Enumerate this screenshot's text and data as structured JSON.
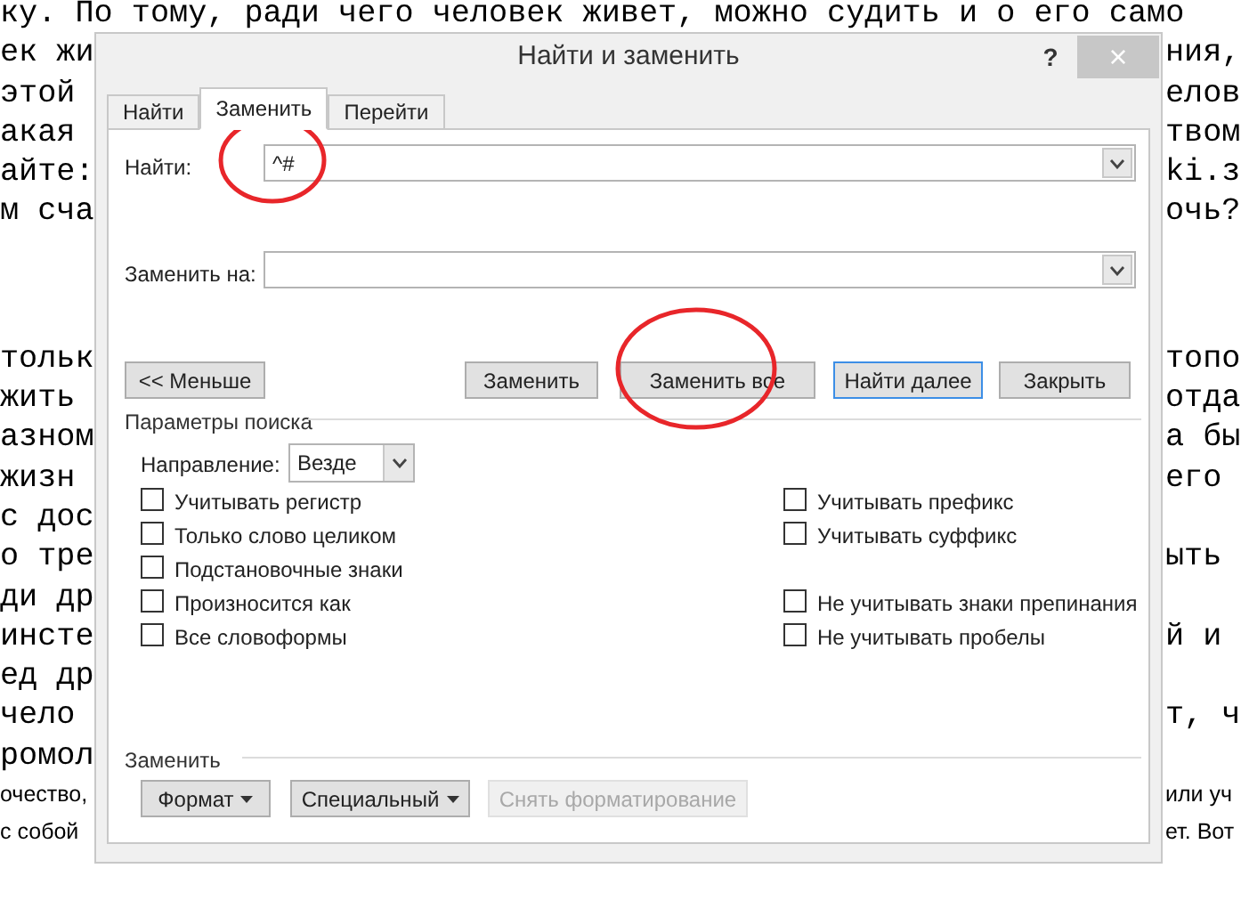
{
  "document": {
    "paragraphs": [
      {
        "kind": "mono",
        "lines": [
          {
            "kind": "full",
            "text": "ку. По тому, ради чего человек живет, можно судить и о его само"
          },
          {
            "kind": "split",
            "left": "ек жи",
            "right": "ния,"
          },
          {
            "kind": "split",
            "left": "этой",
            "right": "елов"
          },
          {
            "kind": "split",
            "left": "акая",
            "right": "твом"
          },
          {
            "kind": "split",
            "left": "айте:",
            "right": "ki.з"
          },
          {
            "kind": "split",
            "left": "м сча",
            "right": "очь?"
          }
        ]
      },
      {
        "kind": "mono",
        "lines": [
          {
            "kind": "split",
            "left": "тольк",
            "right": "топо"
          },
          {
            "kind": "split",
            "left": "жить",
            "right": "отда"
          },
          {
            "kind": "split",
            "left": "азном",
            "right": "а бы"
          },
          {
            "kind": "split",
            "left": "жизн",
            "right": "его"
          },
          {
            "kind": "split",
            "left": "с дос"
          },
          {
            "kind": "split",
            "left": "о тре",
            "right": "ыть"
          },
          {
            "kind": "split",
            "left": "ди др"
          },
          {
            "kind": "split",
            "left": "инсте",
            "right": "й и"
          },
          {
            "kind": "split",
            "left": "ед др"
          },
          {
            "kind": "split",
            "left": "чело",
            "right": "т, ч"
          },
          {
            "kind": "split",
            "left": "ромол"
          }
        ]
      },
      {
        "kind": "sans",
        "lines": [
          {
            "kind": "split",
            "left": "очество,",
            "right": "или уч"
          },
          {
            "kind": "split",
            "left": "с собой",
            "right": "ет. Вот"
          }
        ]
      }
    ]
  },
  "dialog": {
    "title": "Найти и заменить",
    "help": "?",
    "close": "×",
    "tabs": [
      {
        "label": "Найти",
        "selected": false
      },
      {
        "label": "Заменить",
        "selected": true
      },
      {
        "label": "Перейти",
        "selected": false
      }
    ],
    "find": {
      "label": "Найти:",
      "value": "^#"
    },
    "replace": {
      "label": "Заменить на:"
    },
    "less_button": "<< Меньше",
    "actions": [
      {
        "label": "Заменить",
        "focused": false
      },
      {
        "label": "Заменить все",
        "focused": false
      },
      {
        "label": "Найти далее",
        "focused": true
      },
      {
        "label": "Закрыть",
        "focused": false
      }
    ],
    "options_title": "Параметры поиска",
    "direction": {
      "label": "Направление:",
      "value": "Везде"
    },
    "left_options": [
      {
        "label": "Учитывать регистр",
        "checked": false
      },
      {
        "label": "Только слово целиком",
        "checked": false
      },
      {
        "label": "Подстановочные знаки",
        "checked": false
      },
      {
        "label": "Произносится как",
        "checked": false
      },
      {
        "label": "Все словоформы",
        "checked": false
      }
    ],
    "right_options": [
      {
        "label": "Учитывать префикс",
        "checked": false
      },
      {
        "label": "Учитывать суффикс",
        "checked": false
      },
      {
        "kind": "gap"
      },
      {
        "label": "Не учитывать знаки препинания",
        "checked": false
      },
      {
        "label": "Не учитывать пробелы",
        "checked": false
      }
    ],
    "replace_section": "Заменить",
    "format_buttons": [
      {
        "label": "Формат",
        "menu": true,
        "disabled": false
      },
      {
        "label": "Специальный",
        "menu": true,
        "disabled": false
      },
      {
        "label": "Снять форматирование",
        "menu": false,
        "disabled": true
      }
    ]
  }
}
